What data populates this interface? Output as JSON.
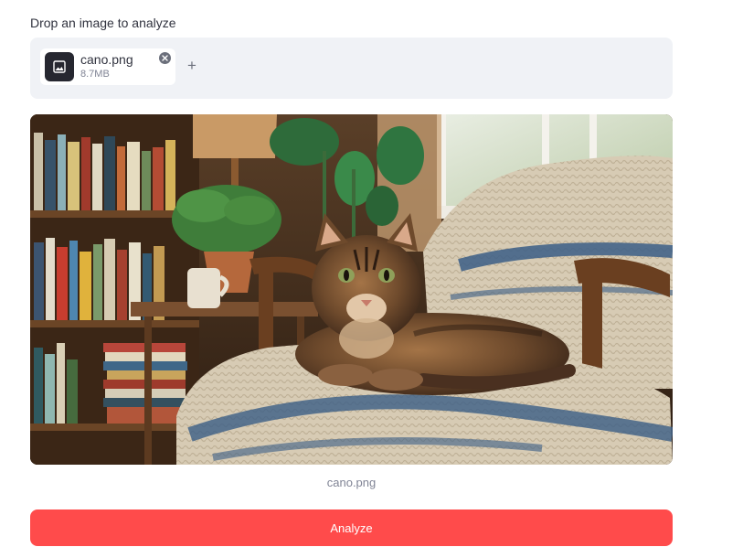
{
  "uploader": {
    "label": "Drop an image to analyze",
    "file": {
      "name": "cano.png",
      "size": "8.7MB",
      "thumb_icon": "image-icon",
      "remove_icon": "close-circle-icon"
    },
    "add_icon": "plus-icon",
    "add_label": "+"
  },
  "preview": {
    "caption": "cano.png",
    "alt": "Tabby cat resting on a knitted blanket in a wooden armchair beside a bookshelf"
  },
  "actions": {
    "analyze_label": "Analyze"
  },
  "colors": {
    "accent": "#ff4b4b",
    "dropzone_bg": "#f0f2f6",
    "text": "#31333f",
    "muted": "#808495"
  }
}
